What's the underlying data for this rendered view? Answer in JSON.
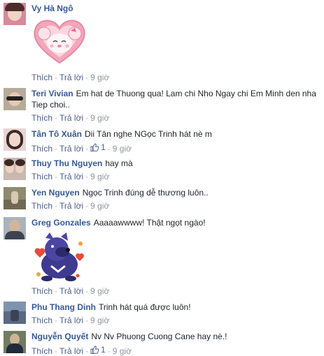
{
  "comments": [
    {
      "name": "Vy Hà Ngô",
      "text": "",
      "like": "Thích",
      "reply": "Trả lời",
      "time": "9 giờ"
    },
    {
      "name": "Teri Vivian",
      "text": "Em hat de Thuong qua! Lam chi Nho Ngay chi Em Minh den nha Tiep choi..",
      "like": "Thích",
      "reply": "Trả lời",
      "time": "9 giờ"
    },
    {
      "name": "Tân Tô Xuân",
      "text": "Dii Tân nghe NGọc Trinh hát nè m",
      "like": "Thích",
      "reply": "Trả lời",
      "likes": "1",
      "time": "9 giờ"
    },
    {
      "name": "Thuy Thu Nguyen",
      "text": "hay mà",
      "like": "Thích",
      "reply": "Trả lời",
      "time": "9 giờ"
    },
    {
      "name": "Yen Nguyen",
      "text": "Ngọc Trinh đúng dễ thương luôn..",
      "like": "Thích",
      "reply": "Trả lời",
      "time": "9 giờ"
    },
    {
      "name": "Greg Gonzales",
      "text": "Aaaaawwww! Thật ngọt ngào!",
      "like": "Thích",
      "reply": "Trả lời",
      "time": "9 giờ"
    },
    {
      "name": "Phu Thang Dinh",
      "text": "Trinh hát quá được luôn!",
      "like": "Thích",
      "reply": "Trả lời",
      "time": "9 giờ"
    },
    {
      "name": "Nguyễn Quyết",
      "text": "Nv Nv Phuong Cuong Cane hay nè.!",
      "like": "Thích",
      "reply": "Trả lời",
      "likes": "1",
      "time": "9 giờ"
    }
  ],
  "icons": {
    "like": "thumbs-up-icon"
  },
  "colors": {
    "name": "#365899",
    "link": "#4b5d8c",
    "meta": "#90949c"
  }
}
